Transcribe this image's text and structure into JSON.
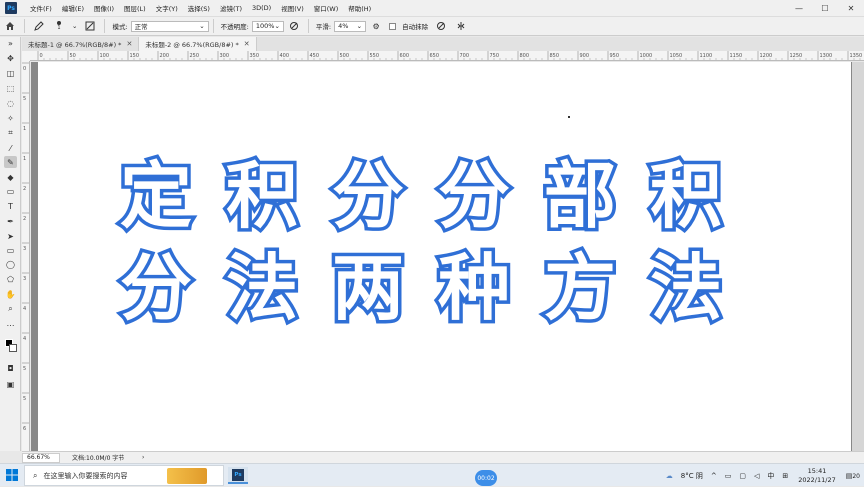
{
  "app": {
    "logo": "Ps",
    "menus": [
      "文件(F)",
      "编辑(E)",
      "图像(I)",
      "图层(L)",
      "文字(Y)",
      "选择(S)",
      "滤镜(T)",
      "3D(D)",
      "视图(V)",
      "窗口(W)",
      "帮助(H)"
    ],
    "window_controls": [
      "—",
      "☐",
      "✕"
    ]
  },
  "options": {
    "brush_size": "1",
    "mode_label": "模式:",
    "mode_value": "正常",
    "opacity_label": "不透明度:",
    "opacity_value": "100%",
    "smooth_label": "平滑:",
    "smooth_value": "4%",
    "auto_erase_label": "自动抹除"
  },
  "tabs": [
    {
      "label": "未标题-1 @ 66.7%(RGB/8#) *",
      "active": false
    },
    {
      "label": "未标题-2 @ 66.7%(RGB/8#) *",
      "active": true
    }
  ],
  "ruler": {
    "h_ticks": [
      "0",
      "50",
      "100",
      "150",
      "200",
      "250",
      "300",
      "350",
      "400",
      "450",
      "500",
      "550",
      "600",
      "650",
      "700",
      "750",
      "800",
      "850",
      "900",
      "950",
      "1000",
      "1050",
      "1100",
      "1150",
      "1200",
      "1250",
      "1300",
      "1350"
    ],
    "v_ticks": [
      "0",
      "5",
      "1",
      "1",
      "2",
      "2",
      "3",
      "3",
      "4",
      "4",
      "5",
      "5",
      "6"
    ]
  },
  "canvas": {
    "line1": "定积分分部积",
    "line2": "分法两种方法",
    "stroke_color": "#2f6fd6",
    "fill_color": "#ffffff"
  },
  "status": {
    "zoom": "66.67%",
    "doc": "文档:10.0M/0 字节",
    "arrow": "›"
  },
  "taskbar": {
    "search_placeholder": "在这里输入你要搜索的内容",
    "ps_icon": "Ps",
    "timer": "00:02",
    "weather": "8°C 阴",
    "ime": "中",
    "time": "15:41",
    "date": "2022/11/27",
    "notification_count": "20"
  }
}
